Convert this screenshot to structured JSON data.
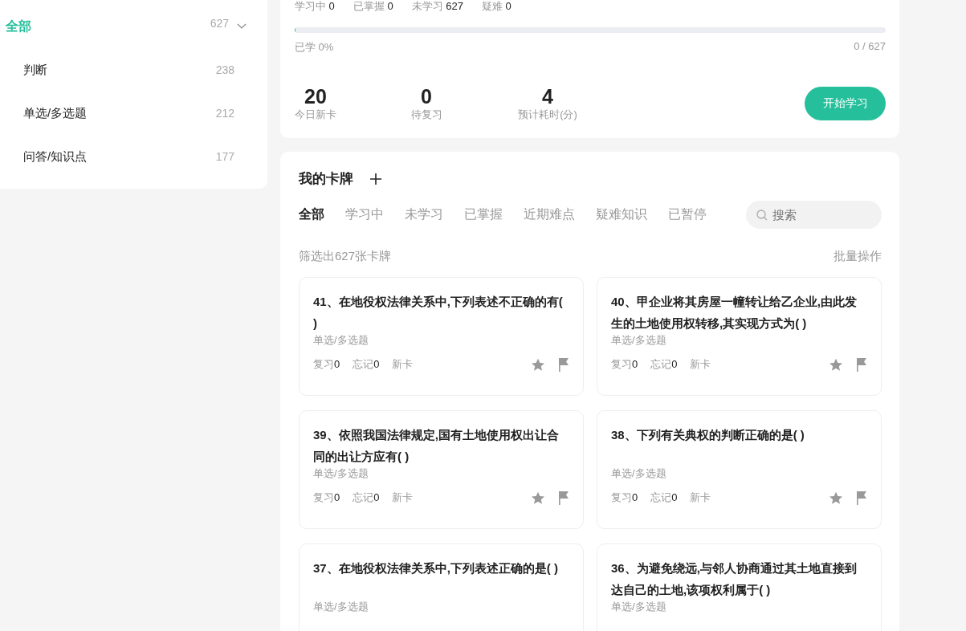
{
  "sidebar": {
    "tree": [
      {
        "label": "全部",
        "count": "627",
        "selected": true,
        "expanded": true,
        "children": [
          {
            "label": "判断",
            "count": "238",
            "selected": false
          },
          {
            "label": "单选/多选题",
            "count": "212",
            "selected": false
          },
          {
            "label": "问答/知识点",
            "count": "177",
            "selected": false
          }
        ]
      }
    ]
  },
  "overview": {
    "stats": [
      {
        "label": "学习中",
        "value": "0"
      },
      {
        "label": "已掌握",
        "value": "0"
      },
      {
        "label": "未学习",
        "value": "627"
      },
      {
        "label": "疑难",
        "value": "0"
      }
    ],
    "progress": {
      "level": 0,
      "label": "已学 0%",
      "reading": "0 / 627"
    },
    "metrics": [
      {
        "value": "20",
        "label": "今日新卡"
      },
      {
        "value": "0",
        "label": "待复习"
      },
      {
        "value": "4",
        "label": "预计耗时(分)"
      }
    ],
    "start_button": "开始学习"
  },
  "deck": {
    "title": "我的卡牌",
    "tabs": [
      {
        "label": "全部",
        "selected": true
      },
      {
        "label": "学习中",
        "selected": false
      },
      {
        "label": "未学习",
        "selected": false
      },
      {
        "label": "已掌握",
        "selected": false
      },
      {
        "label": "近期难点",
        "selected": false
      },
      {
        "label": "疑难知识",
        "selected": false
      },
      {
        "label": "已暂停",
        "selected": false
      }
    ],
    "search": {
      "placeholder": "搜索"
    },
    "filter_summary": "筛选出627张卡牌",
    "bulk_action": "批量操作",
    "cards": [
      {
        "title": "41、在地役权法律关系中,下列表述不正确的有( )",
        "type": "单选/多选题",
        "stats": [
          {
            "label": "复习",
            "value": "0"
          },
          {
            "label": "忘记",
            "value": "0"
          },
          {
            "label": "新卡"
          }
        ]
      },
      {
        "title": "40、甲企业将其房屋一幢转让给乙企业,由此发生的土地使用权转移,其实现方式为( )",
        "type": "单选/多选题",
        "stats": [
          {
            "label": "复习",
            "value": "0"
          },
          {
            "label": "忘记",
            "value": "0"
          },
          {
            "label": "新卡"
          }
        ]
      },
      {
        "title": "39、依照我国法律规定,国有土地使用权出让合同的出让方应有( )",
        "type": "单选/多选题",
        "stats": [
          {
            "label": "复习",
            "value": "0"
          },
          {
            "label": "忘记",
            "value": "0"
          },
          {
            "label": "新卡"
          }
        ]
      },
      {
        "title": "38、下列有关典权的判断正确的是( )",
        "type": "单选/多选题",
        "stats": [
          {
            "label": "复习",
            "value": "0"
          },
          {
            "label": "忘记",
            "value": "0"
          },
          {
            "label": "新卡"
          }
        ]
      },
      {
        "title": "37、在地役权法律关系中,下列表述正确的是( )",
        "type": "单选/多选题"
      },
      {
        "title": "36、为避免绕远,与邻人协商通过其土地直接到达自己的土地,该项权利属于( )",
        "type": "单选/多选题"
      }
    ]
  }
}
